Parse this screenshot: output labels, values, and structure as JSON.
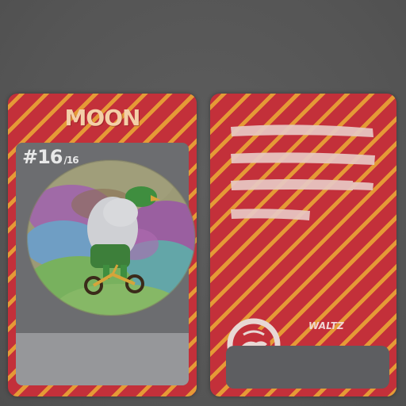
{
  "card": {
    "title": "MOON",
    "number": "#16",
    "total": "/16"
  },
  "back": {
    "brand": "WALTZ",
    "logo": "bird-seal-icon"
  },
  "colors": {
    "card_red": "#c3303a",
    "stripe_orange": "#e59a36",
    "background": "#585858",
    "text_cream": "#f3cfa8"
  }
}
